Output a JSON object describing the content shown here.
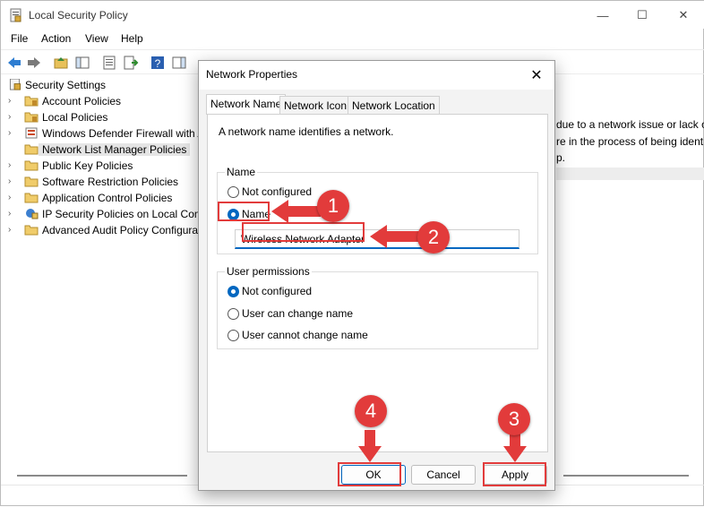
{
  "window": {
    "title": "Local Security Policy",
    "minimize": "—",
    "maximize": "☐",
    "close": "✕"
  },
  "menu": {
    "items": [
      "File",
      "Action",
      "View",
      "Help"
    ]
  },
  "tree": {
    "root": "Security Settings",
    "items": [
      {
        "label": "Account Policies"
      },
      {
        "label": "Local Policies"
      },
      {
        "label": "Windows Defender Firewall with A"
      },
      {
        "label": "Network List Manager Policies"
      },
      {
        "label": "Public Key Policies"
      },
      {
        "label": "Software Restriction Policies"
      },
      {
        "label": "Application Control Policies"
      },
      {
        "label": "IP Security Policies on Local Com"
      },
      {
        "label": "Advanced Audit Policy Configura"
      }
    ]
  },
  "right_pane": {
    "lines": [
      "due to a network issue or lack o",
      "re in the process of being identi",
      "p."
    ]
  },
  "dialog": {
    "title": "Network Properties",
    "close": "✕",
    "tabs": [
      "Network Name",
      "Network Icon",
      "Network Location"
    ],
    "description": "A network name identifies a network.",
    "name_group": {
      "label": "Name",
      "options": [
        "Not configured",
        "Name"
      ],
      "selected": "Name",
      "input_value": "Wireless Network Adapter"
    },
    "permissions_group": {
      "label": "User permissions",
      "options": [
        "Not configured",
        "User can change name",
        "User cannot change name"
      ],
      "selected": "Not configured"
    },
    "buttons": {
      "ok": "OK",
      "cancel": "Cancel",
      "apply": "Apply"
    }
  },
  "annotations": {
    "markers": [
      "1",
      "2",
      "3",
      "4"
    ],
    "color": "#e23b3b"
  },
  "colors": {
    "accent": "#0067c0",
    "annotation": "#e23b3b"
  }
}
